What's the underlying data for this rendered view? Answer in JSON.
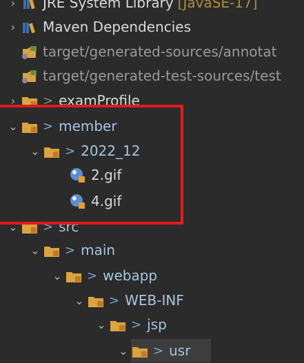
{
  "tree": {
    "rows": [
      {
        "label": "JRE System Library",
        "suffix": "[JavaSE-17]",
        "icon": "library-icon"
      },
      {
        "label": "Maven Dependencies",
        "icon": "library-icon"
      },
      {
        "label": "target/generated-sources/annotat",
        "icon": "source-folder-icon"
      },
      {
        "label": "target/generated-test-sources/test",
        "icon": "source-folder-icon"
      },
      {
        "label": "examProfile",
        "icon": "folder-icon"
      },
      {
        "label": "member",
        "icon": "folder-icon"
      },
      {
        "label": "2022_12",
        "icon": "folder-icon"
      },
      {
        "label": "2.gif",
        "icon": "gif-file-icon"
      },
      {
        "label": "4.gif",
        "icon": "gif-file-icon"
      },
      {
        "label": "src",
        "icon": "folder-icon"
      },
      {
        "label": "main",
        "icon": "folder-icon"
      },
      {
        "label": "webapp",
        "icon": "folder-icon"
      },
      {
        "label": "WEB-INF",
        "icon": "folder-icon"
      },
      {
        "label": "jsp",
        "icon": "folder-icon"
      },
      {
        "label": "usr",
        "icon": "folder-icon"
      }
    ],
    "decorator": ">"
  },
  "colors": {
    "background": "#2b2b2b",
    "highlight_box": "#e41b1b",
    "selected_row": "#3d3d3d"
  }
}
